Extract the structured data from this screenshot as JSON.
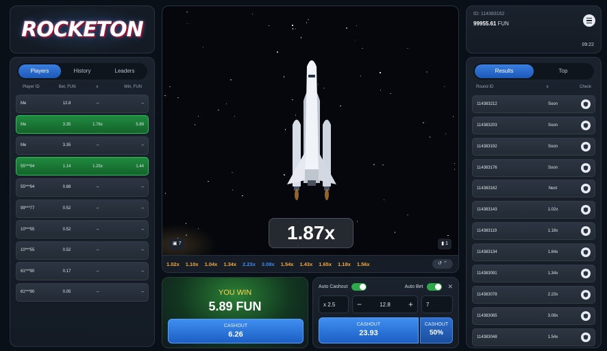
{
  "logo": {
    "text": "ROCKETON"
  },
  "players": {
    "tabs": [
      {
        "label": "Players",
        "active": true
      },
      {
        "label": "History",
        "active": false
      },
      {
        "label": "Leaders",
        "active": false
      }
    ],
    "columns": [
      "Player ID",
      "Bet, FUN",
      "x",
      "Win, FUN"
    ],
    "rows": [
      {
        "id": "Me",
        "bet": "12.8",
        "x": "–",
        "win": "–",
        "won": false
      },
      {
        "id": "Me",
        "bet": "3.35",
        "x": "1.76x",
        "win": "5.89",
        "won": true
      },
      {
        "id": "Me",
        "bet": "3.35",
        "x": "–",
        "win": "–",
        "won": false
      },
      {
        "id": "55***94",
        "bet": "1.14",
        "x": "1.25x",
        "win": "1.44",
        "won": true
      },
      {
        "id": "55***94",
        "bet": "0.88",
        "x": "–",
        "win": "–",
        "won": false
      },
      {
        "id": "99***77",
        "bet": "0.52",
        "x": "–",
        "win": "–",
        "won": false
      },
      {
        "id": "10***55",
        "bet": "0.52",
        "x": "–",
        "win": "–",
        "won": false
      },
      {
        "id": "10***55",
        "bet": "0.52",
        "x": "–",
        "win": "–",
        "won": false
      },
      {
        "id": "61***90",
        "bet": "0.17",
        "x": "–",
        "win": "–",
        "won": false
      },
      {
        "id": "61***90",
        "bet": "0.05",
        "x": "–",
        "win": "–",
        "won": false
      }
    ]
  },
  "game": {
    "multiplier": "1.87x",
    "badge_left": "7",
    "badge_right": "1",
    "history": [
      {
        "value": "1.02x",
        "color": "#f2a93b"
      },
      {
        "value": "1.10x",
        "color": "#f2a93b"
      },
      {
        "value": "1.04x",
        "color": "#f2a93b"
      },
      {
        "value": "1.34x",
        "color": "#f2a93b"
      },
      {
        "value": "2.23x",
        "color": "#3b8cf2"
      },
      {
        "value": "3.08x",
        "color": "#3b8cf2"
      },
      {
        "value": "1.54x",
        "color": "#f2a93b"
      },
      {
        "value": "1.43x",
        "color": "#f2a93b"
      },
      {
        "value": "1.65x",
        "color": "#f2a93b"
      },
      {
        "value": "1.18x",
        "color": "#f2a93b"
      },
      {
        "value": "1.56x",
        "color": "#f2a93b"
      }
    ]
  },
  "win_panel": {
    "title": "YOU WIN",
    "amount": "5.89 FUN",
    "cashout_label": "CASHOUT",
    "cashout_value": "6.26"
  },
  "bet_panel": {
    "auto_cashout_label": "Auto Cashout",
    "auto_bet_label": "Auto Bet",
    "cashout_field": "x 2.5",
    "bet_value": "12.8",
    "rounds_value": "7",
    "cashout_label": "CASHOUT",
    "cashout_value": "23.93",
    "half_label": "CASHOUT",
    "half_value": "50%"
  },
  "user": {
    "id": "ID: 114383162",
    "balance": "99955.61",
    "currency": "FUN",
    "time": "09:22"
  },
  "results": {
    "tabs": [
      {
        "label": "Results",
        "active": true
      },
      {
        "label": "Top",
        "active": false
      }
    ],
    "columns": [
      "Round ID",
      "x",
      "Check"
    ],
    "rows": [
      {
        "id": "114383212",
        "x": "Soon"
      },
      {
        "id": "114383203",
        "x": "Soon"
      },
      {
        "id": "114383192",
        "x": "Soon"
      },
      {
        "id": "114383176",
        "x": "Soon"
      },
      {
        "id": "114383162",
        "x": "Next"
      },
      {
        "id": "114383143",
        "x": "1.02x"
      },
      {
        "id": "114383119",
        "x": "1.18x"
      },
      {
        "id": "114383134",
        "x": "1.84x"
      },
      {
        "id": "114383091",
        "x": "1.34x"
      },
      {
        "id": "114383078",
        "x": "2.23x"
      },
      {
        "id": "114383065",
        "x": "3.08x"
      },
      {
        "id": "114383048",
        "x": "1.54x"
      }
    ]
  }
}
